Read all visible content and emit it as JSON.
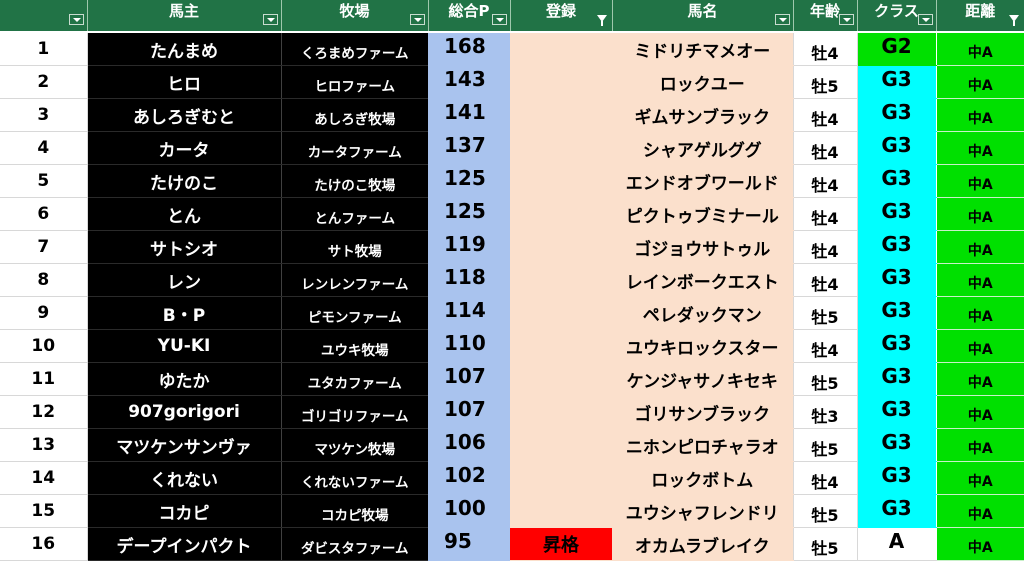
{
  "headers": {
    "num": "",
    "owner": "馬主",
    "farm": "牧場",
    "points": "総合P",
    "registration": "登録",
    "horse": "馬名",
    "age": "年齢",
    "class": "クラス",
    "distance": "距離"
  },
  "colors": {
    "header_bg": "#217346",
    "g2": "#00e000",
    "g3": "#00ffff",
    "a": "#ffffff",
    "promotion_badge": "#ff0000",
    "points_bg": "#a9c3ee",
    "horse_bg": "#fbe0cc",
    "distance_bg": "#00e000"
  },
  "rows": [
    {
      "num": "1",
      "owner": "たんまめ",
      "farm": "くろまめファーム",
      "points": "168",
      "registration": "",
      "horse": "ミドリチマメオー",
      "age": "牡4",
      "class": "G2",
      "distance": "中A"
    },
    {
      "num": "2",
      "owner": "ヒロ",
      "farm": "ヒロファーム",
      "points": "143",
      "registration": "",
      "horse": "ロックユー",
      "age": "牡5",
      "class": "G3",
      "distance": "中A"
    },
    {
      "num": "3",
      "owner": "あしろぎむと",
      "farm": "あしろぎ牧場",
      "points": "141",
      "registration": "",
      "horse": "ギムサンブラック",
      "age": "牡4",
      "class": "G3",
      "distance": "中A"
    },
    {
      "num": "4",
      "owner": "カータ",
      "farm": "カータファーム",
      "points": "137",
      "registration": "",
      "horse": "シャアゲルググ",
      "age": "牡4",
      "class": "G3",
      "distance": "中A"
    },
    {
      "num": "5",
      "owner": "たけのこ",
      "farm": "たけのこ牧場",
      "points": "125",
      "registration": "",
      "horse": "エンドオブワールド",
      "age": "牡4",
      "class": "G3",
      "distance": "中A"
    },
    {
      "num": "6",
      "owner": "とん",
      "farm": "とんファーム",
      "points": "125",
      "registration": "",
      "horse": "ピクトゥブミナール",
      "age": "牡4",
      "class": "G3",
      "distance": "中A"
    },
    {
      "num": "7",
      "owner": "サトシオ",
      "farm": "サト牧場",
      "points": "119",
      "registration": "",
      "horse": "ゴジョウサトゥル",
      "age": "牡4",
      "class": "G3",
      "distance": "中A"
    },
    {
      "num": "8",
      "owner": "レン",
      "farm": "レンレンファーム",
      "points": "118",
      "registration": "",
      "horse": "レインボークエスト",
      "age": "牡4",
      "class": "G3",
      "distance": "中A"
    },
    {
      "num": "9",
      "owner": "B・P",
      "farm": "ピモンファーム",
      "points": "114",
      "registration": "",
      "horse": "ペレダックマン",
      "age": "牡5",
      "class": "G3",
      "distance": "中A"
    },
    {
      "num": "10",
      "owner": "YU-KI",
      "farm": "ユウキ牧場",
      "points": "110",
      "registration": "",
      "horse": "ユウキロックスター",
      "age": "牡4",
      "class": "G3",
      "distance": "中A"
    },
    {
      "num": "11",
      "owner": "ゆたか",
      "farm": "ユタカファーム",
      "points": "107",
      "registration": "",
      "horse": "ケンジャサノキセキ",
      "age": "牡5",
      "class": "G3",
      "distance": "中A"
    },
    {
      "num": "12",
      "owner": "907gorigori",
      "farm": "ゴリゴリファーム",
      "points": "107",
      "registration": "",
      "horse": "ゴリサンブラック",
      "age": "牡3",
      "class": "G3",
      "distance": "中A"
    },
    {
      "num": "13",
      "owner": "マツケンサンヴァ",
      "farm": "マツケン牧場",
      "points": "106",
      "registration": "",
      "horse": "ニホンピロチャラオ",
      "age": "牡5",
      "class": "G3",
      "distance": "中A"
    },
    {
      "num": "14",
      "owner": "くれない",
      "farm": "くれないファーム",
      "points": "102",
      "registration": "",
      "horse": "ロックボトム",
      "age": "牡4",
      "class": "G3",
      "distance": "中A"
    },
    {
      "num": "15",
      "owner": "コカピ",
      "farm": "コカピ牧場",
      "points": "100",
      "registration": "",
      "horse": "ユウシャフレンドリ",
      "age": "牡5",
      "class": "G3",
      "distance": "中A"
    },
    {
      "num": "16",
      "owner": "デープインパクト",
      "farm": "ダビスタファーム",
      "points": "95",
      "registration": "昇格",
      "horse": "オカムラブレイク",
      "age": "牡5",
      "class": "A",
      "distance": "中A"
    }
  ]
}
